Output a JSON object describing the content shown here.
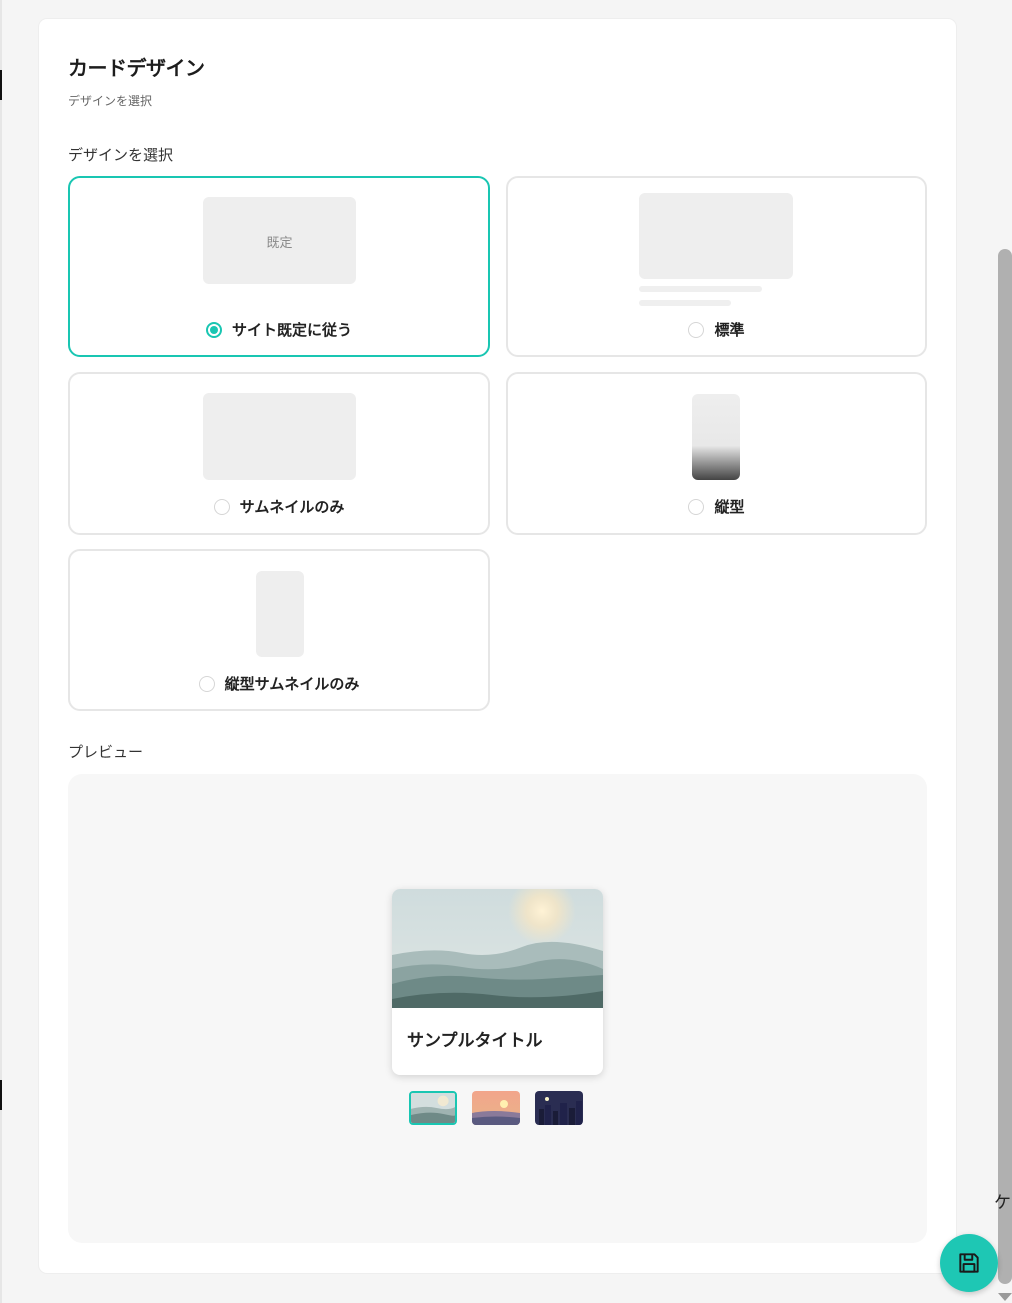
{
  "panel": {
    "title": "カードデザイン",
    "subtitle": "デザインを選択"
  },
  "design_section": {
    "label": "デザインを選択",
    "options": [
      {
        "label": "サイト既定に従う",
        "thumb_text": "既定",
        "selected": true
      },
      {
        "label": "標準",
        "selected": false
      },
      {
        "label": "サムネイルのみ",
        "selected": false
      },
      {
        "label": "縦型",
        "selected": false
      },
      {
        "label": "縦型サムネイルのみ",
        "selected": false
      }
    ]
  },
  "preview_section": {
    "label": "プレビュー",
    "card_title": "サンプルタイトル",
    "image_themes": [
      "mountain",
      "sunset",
      "night-city"
    ],
    "active_theme": "mountain"
  },
  "edge_text": "ケ",
  "colors": {
    "accent": "#19c6b2",
    "fab": "#1ec7b4",
    "border": "#e6e6e6",
    "placeholder": "#eeeeee"
  },
  "icons": {
    "fab": "save-icon"
  }
}
